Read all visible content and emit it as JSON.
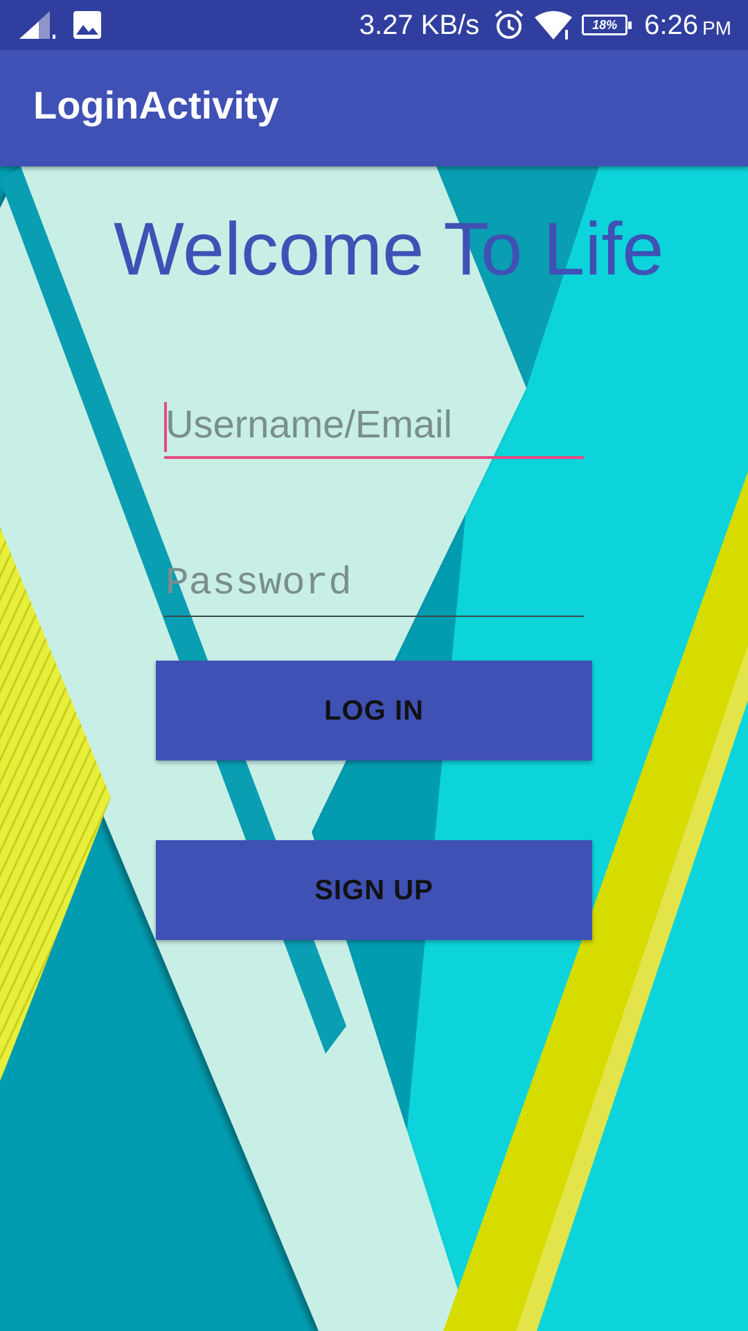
{
  "status_bar": {
    "network_speed": "3.27 KB/s",
    "battery_percent": "18%",
    "time": "6:26",
    "ampm": "PM",
    "icons": [
      "signal-icon",
      "image-icon",
      "alarm-icon",
      "wifi-icon",
      "battery-icon"
    ]
  },
  "app_bar": {
    "title": "LoginActivity"
  },
  "main": {
    "welcome_text": "Welcome To Life",
    "username": {
      "placeholder": "Username/Email",
      "value": ""
    },
    "password": {
      "placeholder": "Password",
      "value": ""
    },
    "login_label": "LOG IN",
    "signup_label": "SIGN UP"
  },
  "colors": {
    "status_bar": "#303f9f",
    "primary": "#3f51b5",
    "accent": "#e84b7d",
    "bg_teal_dark": "#029cb0",
    "bg_mint": "#c8efe6",
    "bg_cyan": "#0dd4da",
    "bg_yellow": "#d6dc00"
  }
}
